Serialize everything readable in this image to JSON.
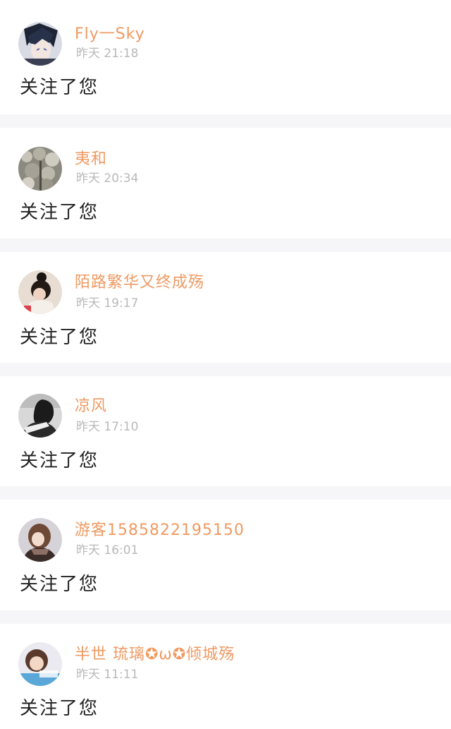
{
  "notifications": [
    {
      "name": "Fly一Sky",
      "time": "昨天 21:18",
      "action": "关注了您",
      "avatar_icon": "anime-boy-avatar"
    },
    {
      "name": "夷和",
      "time": "昨天 20:34",
      "action": "关注了您",
      "avatar_icon": "cherry-blossom-avatar"
    },
    {
      "name": "陌路繁华又终成殇",
      "time": "昨天 19:17",
      "action": "关注了您",
      "avatar_icon": "girl-bun-avatar"
    },
    {
      "name": "凉风",
      "time": "昨天 17:10",
      "action": "关注了您",
      "avatar_icon": "bw-portrait-avatar"
    },
    {
      "name": "游客158582219515​0",
      "time": "昨天 16:01",
      "action": "关注了您",
      "avatar_icon": "girl-scarf-avatar"
    },
    {
      "name": "半世 琉璃✪ω✪倾城殇",
      "time": "昨天 11:11",
      "action": "关注了您",
      "avatar_icon": "girl-photo-avatar"
    }
  ],
  "colors": {
    "name": "#ef9a63",
    "time": "#b9b9b9",
    "action": "#222222",
    "card": "#ffffff",
    "separator": "#f6f5f7"
  }
}
